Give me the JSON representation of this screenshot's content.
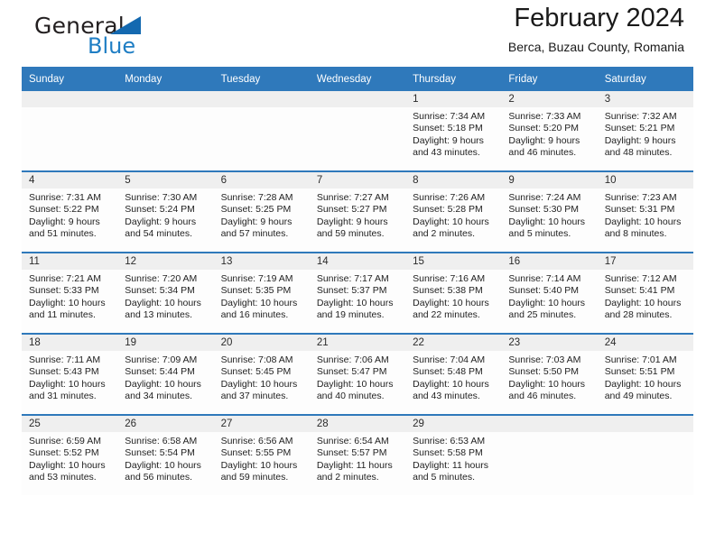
{
  "brand": {
    "name_part1": "General",
    "name_part2": "Blue",
    "accent_color": "#1f7ec4",
    "triangle_color": "#1469b0"
  },
  "header": {
    "title": "February 2024",
    "subtitle": "Berca, Buzau County, Romania"
  },
  "calendar": {
    "header_bg": "#2f79bb",
    "daynum_bg": "#efefef",
    "weekday_headers": [
      "Sunday",
      "Monday",
      "Tuesday",
      "Wednesday",
      "Thursday",
      "Friday",
      "Saturday"
    ],
    "weeks": [
      [
        {
          "day": "",
          "empty": true
        },
        {
          "day": "",
          "empty": true
        },
        {
          "day": "",
          "empty": true
        },
        {
          "day": "",
          "empty": true
        },
        {
          "day": "1",
          "sunrise": "Sunrise: 7:34 AM",
          "sunset": "Sunset: 5:18 PM",
          "daylight": "Daylight: 9 hours and 43 minutes."
        },
        {
          "day": "2",
          "sunrise": "Sunrise: 7:33 AM",
          "sunset": "Sunset: 5:20 PM",
          "daylight": "Daylight: 9 hours and 46 minutes."
        },
        {
          "day": "3",
          "sunrise": "Sunrise: 7:32 AM",
          "sunset": "Sunset: 5:21 PM",
          "daylight": "Daylight: 9 hours and 48 minutes."
        }
      ],
      [
        {
          "day": "4",
          "sunrise": "Sunrise: 7:31 AM",
          "sunset": "Sunset: 5:22 PM",
          "daylight": "Daylight: 9 hours and 51 minutes."
        },
        {
          "day": "5",
          "sunrise": "Sunrise: 7:30 AM",
          "sunset": "Sunset: 5:24 PM",
          "daylight": "Daylight: 9 hours and 54 minutes."
        },
        {
          "day": "6",
          "sunrise": "Sunrise: 7:28 AM",
          "sunset": "Sunset: 5:25 PM",
          "daylight": "Daylight: 9 hours and 57 minutes."
        },
        {
          "day": "7",
          "sunrise": "Sunrise: 7:27 AM",
          "sunset": "Sunset: 5:27 PM",
          "daylight": "Daylight: 9 hours and 59 minutes."
        },
        {
          "day": "8",
          "sunrise": "Sunrise: 7:26 AM",
          "sunset": "Sunset: 5:28 PM",
          "daylight": "Daylight: 10 hours and 2 minutes."
        },
        {
          "day": "9",
          "sunrise": "Sunrise: 7:24 AM",
          "sunset": "Sunset: 5:30 PM",
          "daylight": "Daylight: 10 hours and 5 minutes."
        },
        {
          "day": "10",
          "sunrise": "Sunrise: 7:23 AM",
          "sunset": "Sunset: 5:31 PM",
          "daylight": "Daylight: 10 hours and 8 minutes."
        }
      ],
      [
        {
          "day": "11",
          "sunrise": "Sunrise: 7:21 AM",
          "sunset": "Sunset: 5:33 PM",
          "daylight": "Daylight: 10 hours and 11 minutes."
        },
        {
          "day": "12",
          "sunrise": "Sunrise: 7:20 AM",
          "sunset": "Sunset: 5:34 PM",
          "daylight": "Daylight: 10 hours and 13 minutes."
        },
        {
          "day": "13",
          "sunrise": "Sunrise: 7:19 AM",
          "sunset": "Sunset: 5:35 PM",
          "daylight": "Daylight: 10 hours and 16 minutes."
        },
        {
          "day": "14",
          "sunrise": "Sunrise: 7:17 AM",
          "sunset": "Sunset: 5:37 PM",
          "daylight": "Daylight: 10 hours and 19 minutes."
        },
        {
          "day": "15",
          "sunrise": "Sunrise: 7:16 AM",
          "sunset": "Sunset: 5:38 PM",
          "daylight": "Daylight: 10 hours and 22 minutes."
        },
        {
          "day": "16",
          "sunrise": "Sunrise: 7:14 AM",
          "sunset": "Sunset: 5:40 PM",
          "daylight": "Daylight: 10 hours and 25 minutes."
        },
        {
          "day": "17",
          "sunrise": "Sunrise: 7:12 AM",
          "sunset": "Sunset: 5:41 PM",
          "daylight": "Daylight: 10 hours and 28 minutes."
        }
      ],
      [
        {
          "day": "18",
          "sunrise": "Sunrise: 7:11 AM",
          "sunset": "Sunset: 5:43 PM",
          "daylight": "Daylight: 10 hours and 31 minutes."
        },
        {
          "day": "19",
          "sunrise": "Sunrise: 7:09 AM",
          "sunset": "Sunset: 5:44 PM",
          "daylight": "Daylight: 10 hours and 34 minutes."
        },
        {
          "day": "20",
          "sunrise": "Sunrise: 7:08 AM",
          "sunset": "Sunset: 5:45 PM",
          "daylight": "Daylight: 10 hours and 37 minutes."
        },
        {
          "day": "21",
          "sunrise": "Sunrise: 7:06 AM",
          "sunset": "Sunset: 5:47 PM",
          "daylight": "Daylight: 10 hours and 40 minutes."
        },
        {
          "day": "22",
          "sunrise": "Sunrise: 7:04 AM",
          "sunset": "Sunset: 5:48 PM",
          "daylight": "Daylight: 10 hours and 43 minutes."
        },
        {
          "day": "23",
          "sunrise": "Sunrise: 7:03 AM",
          "sunset": "Sunset: 5:50 PM",
          "daylight": "Daylight: 10 hours and 46 minutes."
        },
        {
          "day": "24",
          "sunrise": "Sunrise: 7:01 AM",
          "sunset": "Sunset: 5:51 PM",
          "daylight": "Daylight: 10 hours and 49 minutes."
        }
      ],
      [
        {
          "day": "25",
          "sunrise": "Sunrise: 6:59 AM",
          "sunset": "Sunset: 5:52 PM",
          "daylight": "Daylight: 10 hours and 53 minutes."
        },
        {
          "day": "26",
          "sunrise": "Sunrise: 6:58 AM",
          "sunset": "Sunset: 5:54 PM",
          "daylight": "Daylight: 10 hours and 56 minutes."
        },
        {
          "day": "27",
          "sunrise": "Sunrise: 6:56 AM",
          "sunset": "Sunset: 5:55 PM",
          "daylight": "Daylight: 10 hours and 59 minutes."
        },
        {
          "day": "28",
          "sunrise": "Sunrise: 6:54 AM",
          "sunset": "Sunset: 5:57 PM",
          "daylight": "Daylight: 11 hours and 2 minutes."
        },
        {
          "day": "29",
          "sunrise": "Sunrise: 6:53 AM",
          "sunset": "Sunset: 5:58 PM",
          "daylight": "Daylight: 11 hours and 5 minutes."
        },
        {
          "day": "",
          "empty": true
        },
        {
          "day": "",
          "empty": true
        }
      ]
    ]
  }
}
